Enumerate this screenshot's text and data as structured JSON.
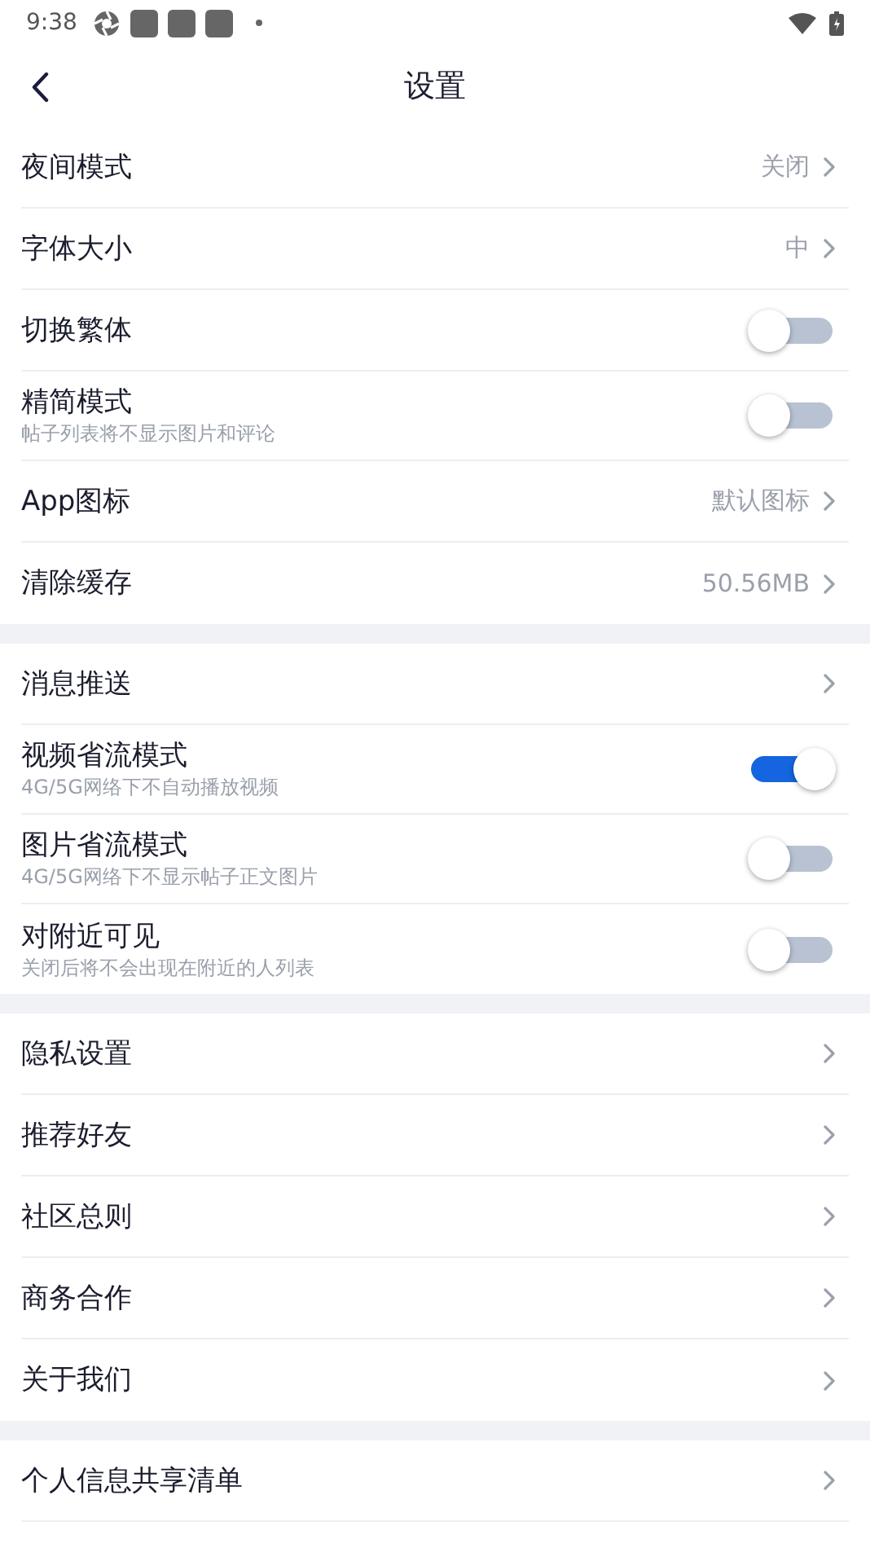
{
  "status_bar": {
    "time": "9:38"
  },
  "header": {
    "title": "设置"
  },
  "groups": [
    {
      "rows": [
        {
          "kind": "link",
          "label": "夜间模式",
          "value": "关闭"
        },
        {
          "kind": "link",
          "label": "字体大小",
          "value": "中"
        },
        {
          "kind": "toggle",
          "label": "切换繁体",
          "on": false
        },
        {
          "kind": "toggle",
          "label": "精简模式",
          "subtitle": "帖子列表将不显示图片和评论",
          "on": false
        },
        {
          "kind": "link",
          "label": "App图标",
          "value": "默认图标"
        },
        {
          "kind": "link",
          "label": "清除缓存",
          "value": "50.56MB"
        }
      ]
    },
    {
      "rows": [
        {
          "kind": "link",
          "label": "消息推送"
        },
        {
          "kind": "toggle",
          "label": "视频省流模式",
          "subtitle": "4G/5G网络下不自动播放视频",
          "on": true
        },
        {
          "kind": "toggle",
          "label": "图片省流模式",
          "subtitle": "4G/5G网络下不显示帖子正文图片",
          "on": false
        },
        {
          "kind": "toggle",
          "label": "对附近可见",
          "subtitle": "关闭后将不会出现在附近的人列表",
          "on": false
        }
      ]
    },
    {
      "rows": [
        {
          "kind": "link",
          "label": "隐私设置"
        },
        {
          "kind": "link",
          "label": "推荐好友"
        },
        {
          "kind": "link",
          "label": "社区总则"
        },
        {
          "kind": "link",
          "label": "商务合作"
        },
        {
          "kind": "link",
          "label": "关于我们"
        }
      ]
    },
    {
      "rows": [
        {
          "kind": "link",
          "label": "个人信息共享清单"
        }
      ]
    }
  ]
}
